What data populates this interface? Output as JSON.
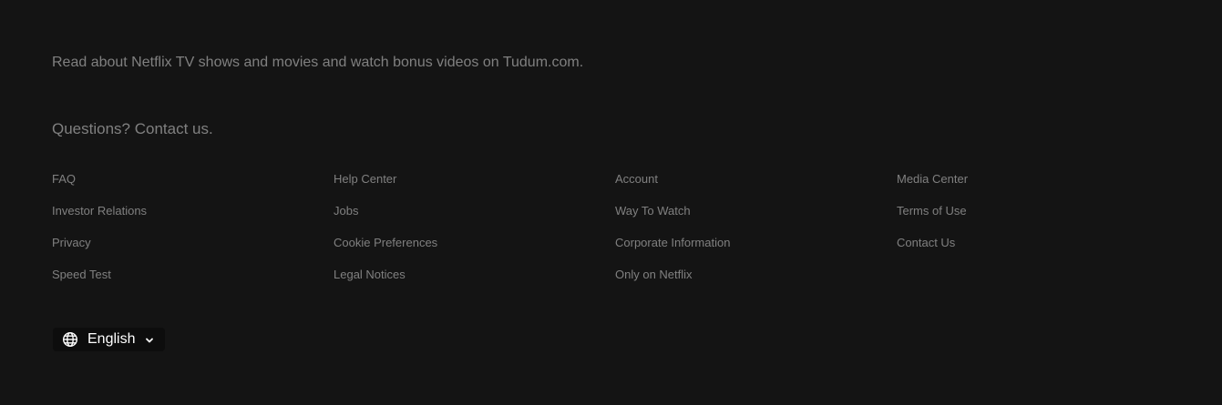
{
  "footer": {
    "tudum_text": "Read about Netflix TV shows and movies and watch bonus videos on Tudum.com.",
    "contact_text": "Questions? Contact us.",
    "links": [
      "FAQ",
      "Help Center",
      "Account",
      "Media Center",
      "Investor Relations",
      "Jobs",
      "Way To Watch",
      "Terms of Use",
      "Privacy",
      "Cookie Preferences",
      "Corporate Information",
      "Contact Us",
      "Speed Test",
      "Legal Notices",
      "Only on Netflix"
    ],
    "language": {
      "label": "English",
      "icon": "globe-icon",
      "chevron_icon": "chevron-down-icon"
    }
  },
  "colors": {
    "background": "#141414",
    "text_muted": "#808080",
    "text_bright": "#ffffff",
    "select_bg": "#0d0d0d"
  }
}
